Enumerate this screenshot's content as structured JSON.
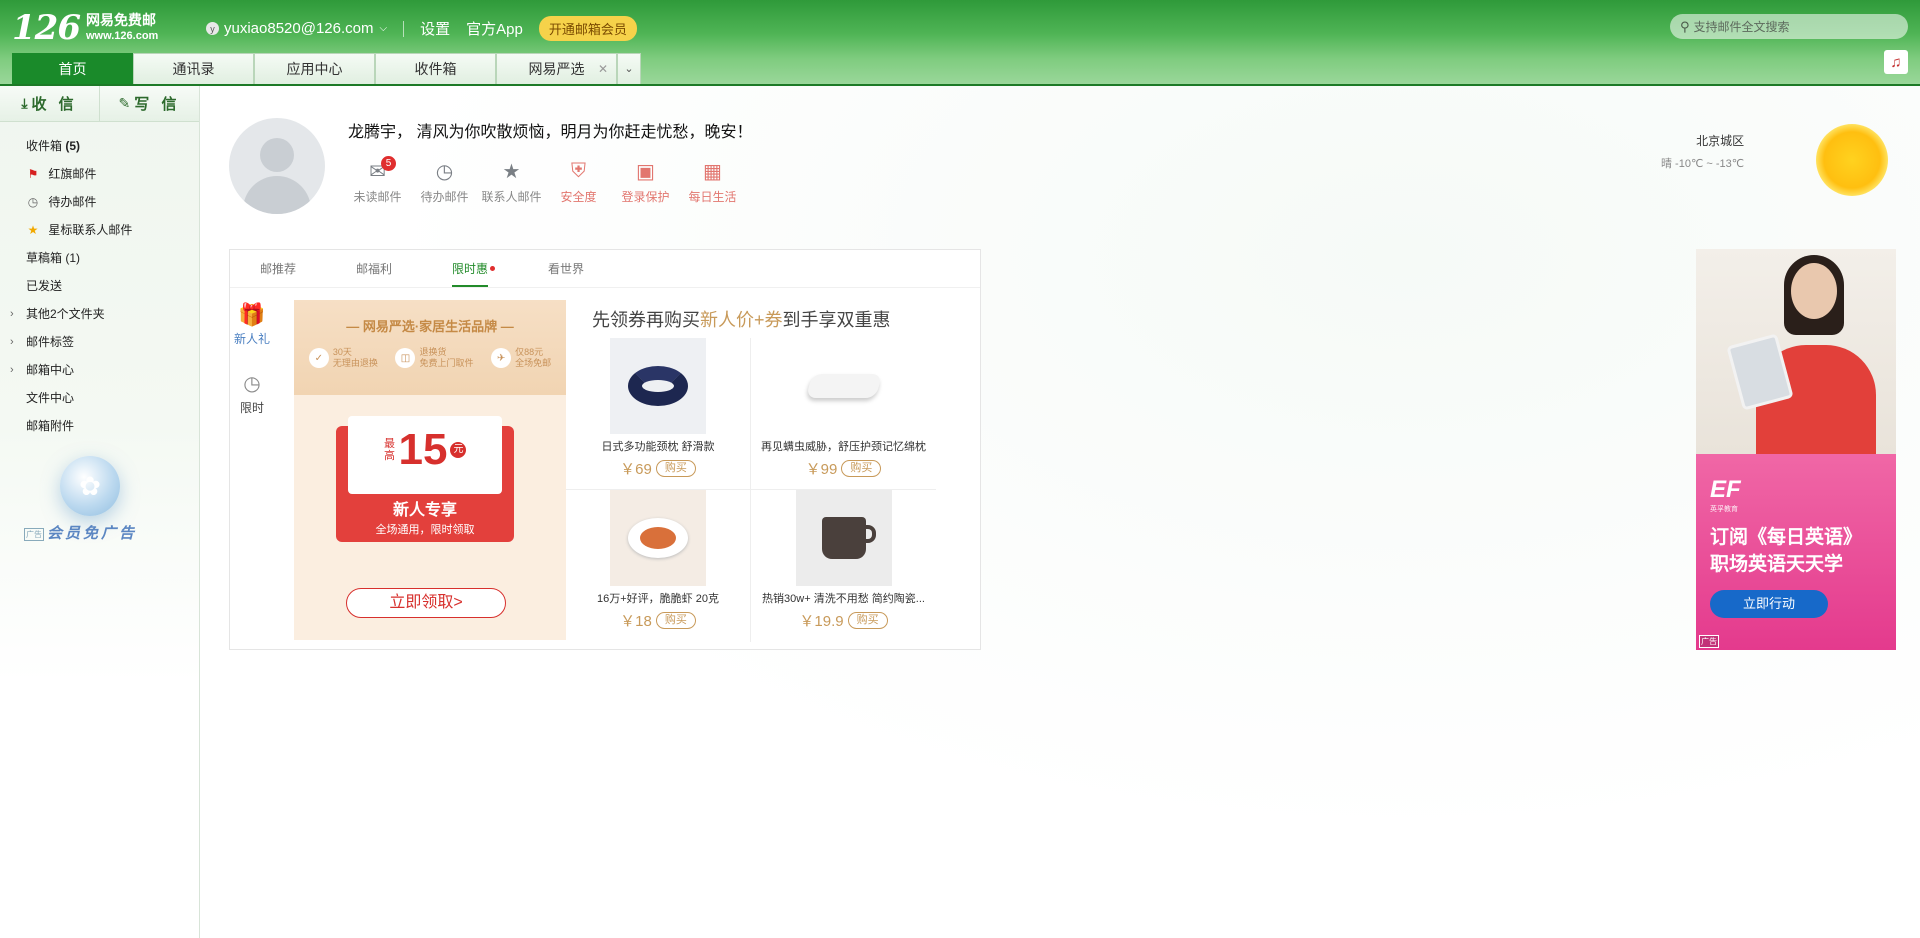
{
  "header": {
    "logo_number": "126",
    "logo_title": "网易免费邮",
    "logo_domain": "www.126.com",
    "account_initial": "y",
    "account_email": "yuxiao8520@126.com",
    "settings": "设置",
    "official_app": "官方App",
    "vip_button": "开通邮箱会员",
    "search_placeholder": "支持邮件全文搜索",
    "tabs": [
      {
        "label": "首页"
      },
      {
        "label": "通讯录"
      },
      {
        "label": "应用中心"
      },
      {
        "label": "收件箱"
      },
      {
        "label": "网易严选"
      }
    ]
  },
  "sidebar": {
    "receive": "收 信",
    "compose": "写 信",
    "folders": [
      {
        "label": "收件箱",
        "count": "(5)"
      },
      {
        "label": "红旗邮件"
      },
      {
        "label": "待办邮件"
      },
      {
        "label": "星标联系人邮件"
      },
      {
        "label": "草稿箱 (1)"
      },
      {
        "label": "已发送"
      },
      {
        "label": "其他2个文件夹"
      },
      {
        "label": "邮件标签"
      },
      {
        "label": "邮箱中心"
      },
      {
        "label": "文件中心"
      },
      {
        "label": "邮箱附件"
      }
    ],
    "ad_tag": "广告",
    "vip_ad": "会员免广告"
  },
  "main": {
    "greeting": "龙腾宇， 清风为你吹散烦恼，明月为你赶走忧愁，晚安！",
    "quick_links": [
      {
        "label": "未读邮件",
        "badge": "5"
      },
      {
        "label": "待办邮件"
      },
      {
        "label": "联系人邮件"
      },
      {
        "label": "安全度"
      },
      {
        "label": "登录保护"
      },
      {
        "label": "每日生活"
      }
    ],
    "weather": {
      "city": "北京城区",
      "desc": "晴 -10℃ ~ -13℃"
    }
  },
  "promo": {
    "tabs": [
      "邮推荐",
      "邮福利",
      "限时惠",
      "看世界"
    ],
    "side": [
      {
        "label": "新人礼"
      },
      {
        "label": "限时"
      }
    ],
    "coupon": {
      "brand": "— 网易严选·家居生活品牌 —",
      "features": [
        {
          "l1": "30天",
          "l2": "无理由退换"
        },
        {
          "l1": "退换货",
          "l2": "免费上门取件"
        },
        {
          "l1": "仅88元",
          "l2": "全场免邮"
        }
      ],
      "amount_prefix": "最高",
      "amount": "15",
      "amount_unit": "元",
      "title": "新人专享",
      "subtitle": "全场通用，限时领取",
      "claim": "立即领取>"
    },
    "headline_a": "先领券再购买",
    "headline_hl": "新人价+券",
    "headline_b": "到手享双重惠",
    "products": [
      {
        "name": "日式多功能颈枕 舒滑款",
        "price": "￥69",
        "buy": "购买"
      },
      {
        "name": "再见螨虫威胁，舒压护颈记忆绵枕",
        "price": "￥99",
        "buy": "购买"
      },
      {
        "name": "16万+好评，脆脆虾 20克",
        "price": "￥18",
        "buy": "购买"
      },
      {
        "name": "热销30w+ 清洗不用愁 简约陶瓷...",
        "price": "￥19.9",
        "buy": "购买"
      }
    ]
  },
  "right_ad": {
    "brand": "EF",
    "brand_sub": "英孚教育",
    "line1": "订阅《每日英语》",
    "line2": "职场英语天天学",
    "button": "立即行动",
    "tag": "广告"
  }
}
